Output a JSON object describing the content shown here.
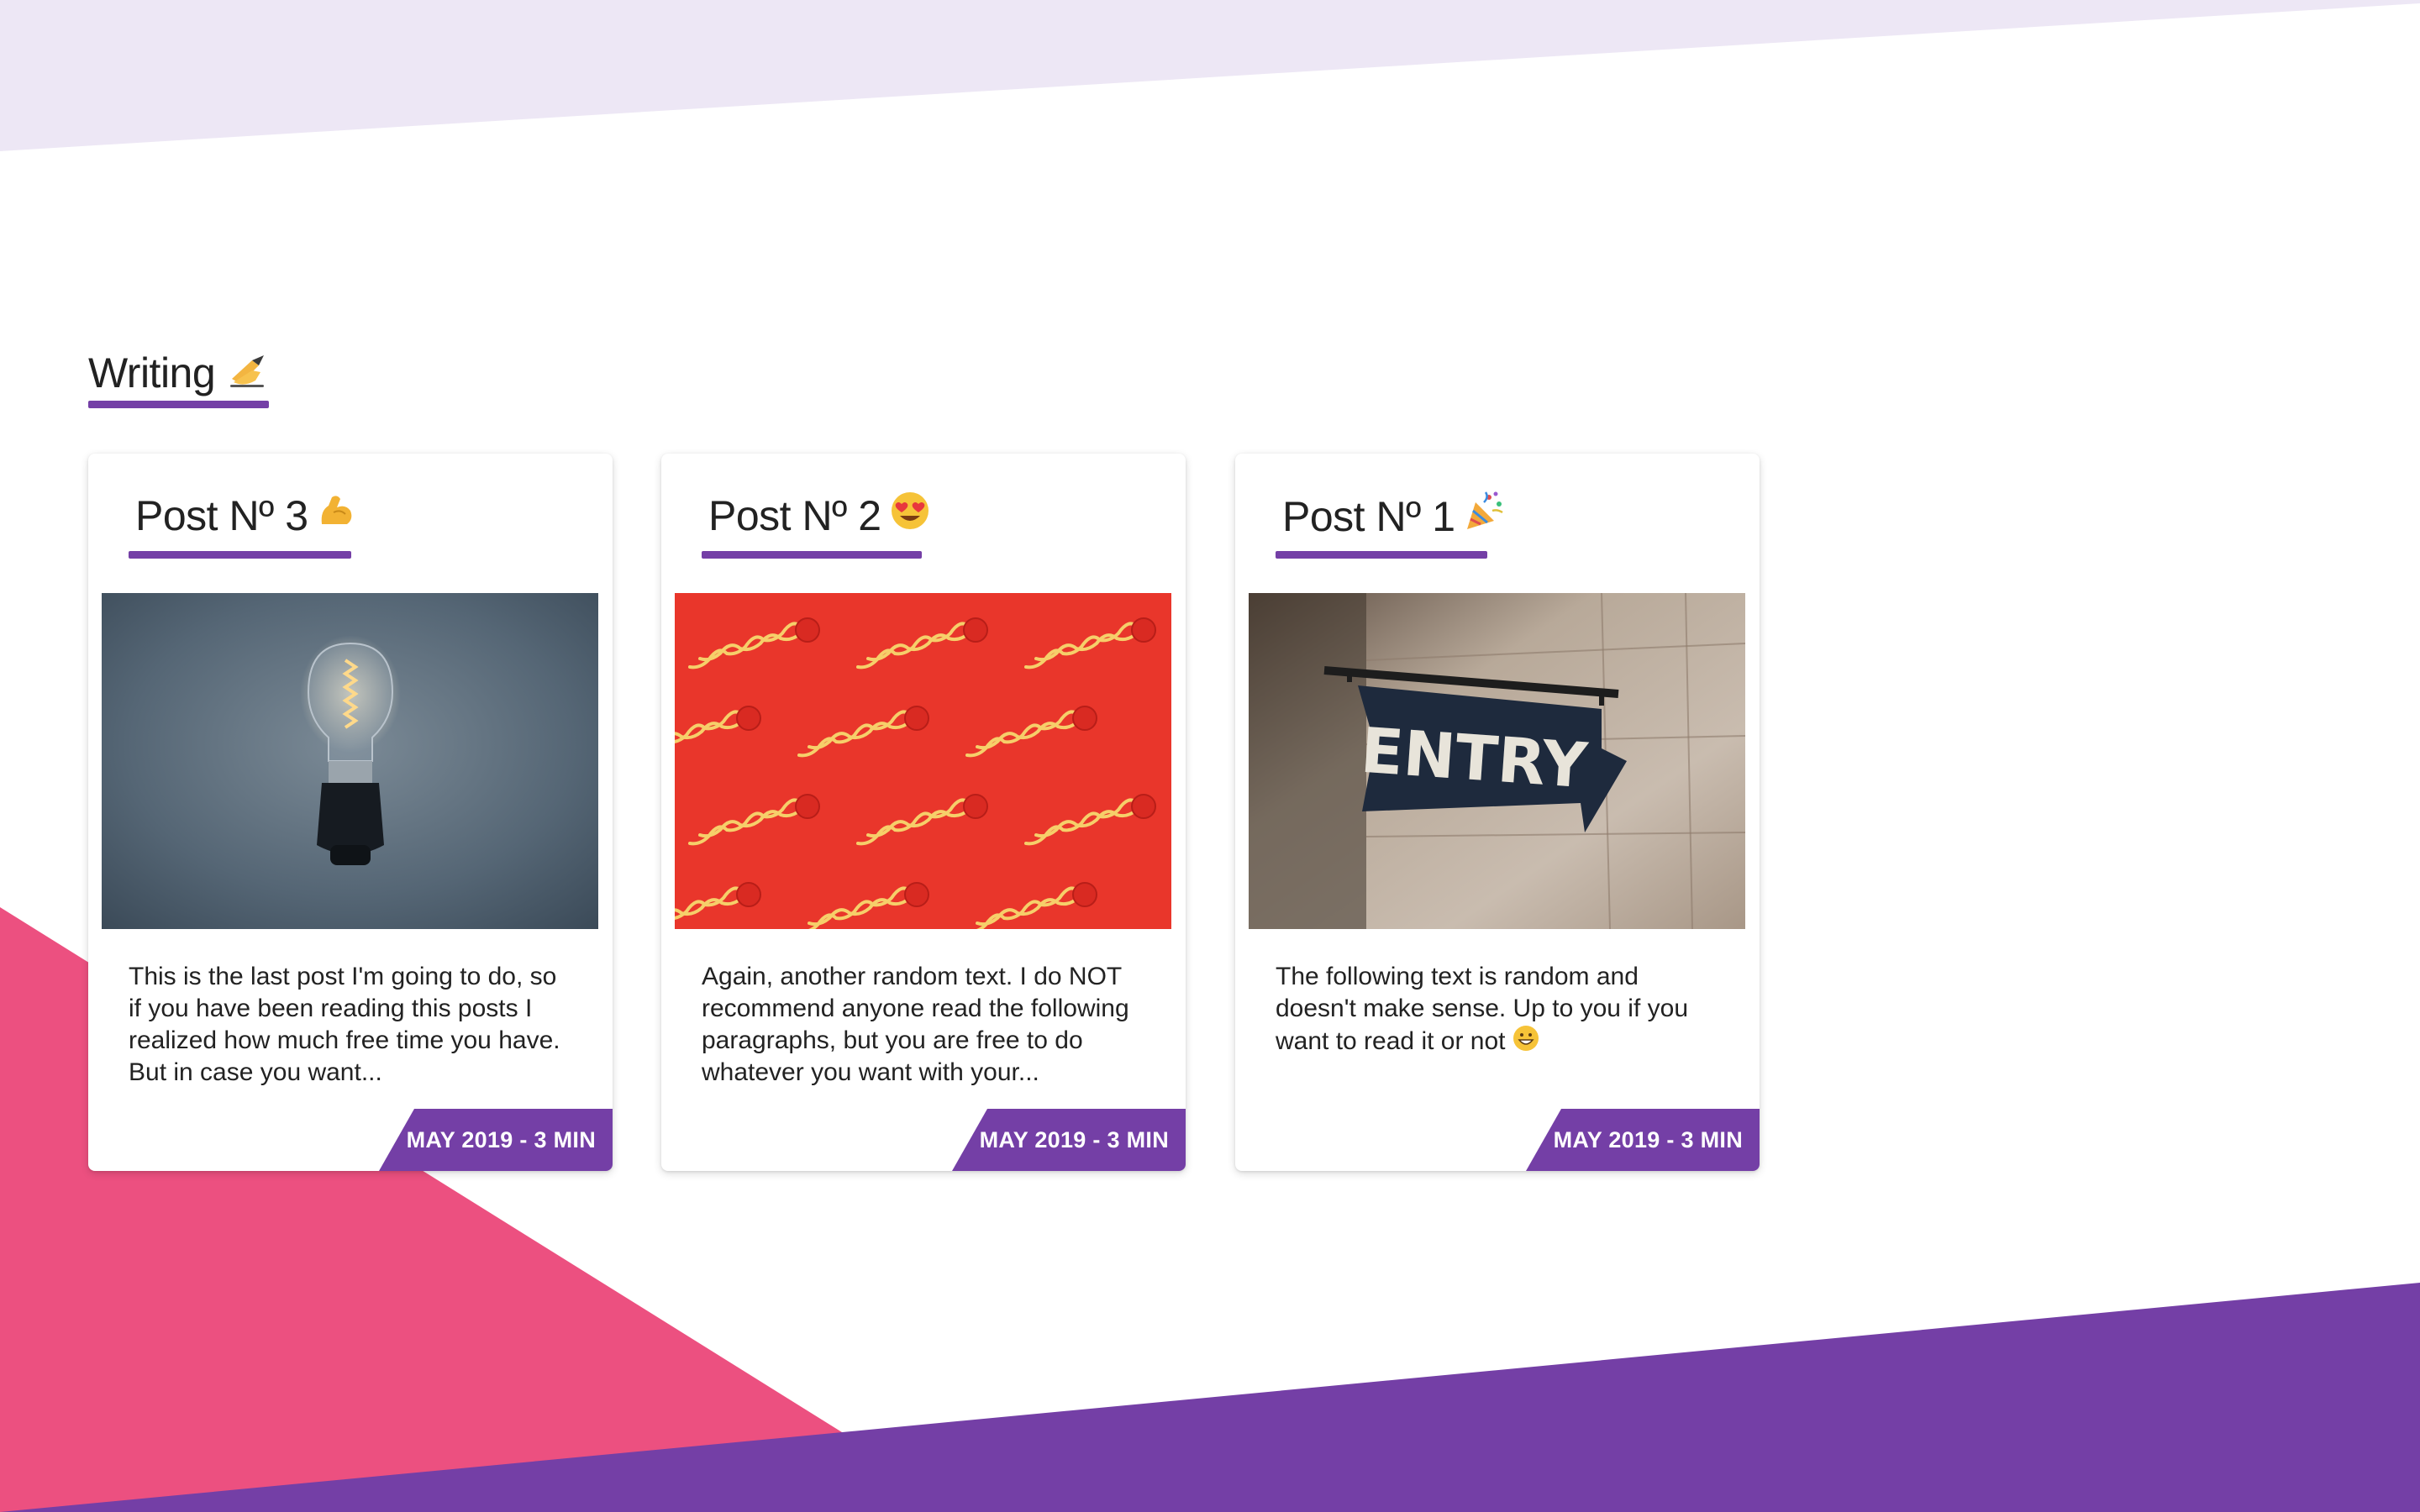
{
  "colors": {
    "accent": "#743fa6",
    "pink": "#ec5080",
    "top_band": "#ede7f5",
    "text": "#222222"
  },
  "section": {
    "title": "Writing",
    "icon": "writing-hand-icon"
  },
  "posts": [
    {
      "title": "Post Nº 3",
      "icon": "flexed-biceps-icon",
      "image": "lightbulb-photo",
      "excerpt": "This is the last post I'm going to do, so if you have been reading this posts I realized how much free time you have. But in case you want...",
      "meta": "MAY 2019 - 3 MIN"
    },
    {
      "title": "Post Nº 2",
      "icon": "heart-eyes-face-icon",
      "image": "noodles-photo",
      "excerpt": "Again, another random text. I do NOT recommend anyone read the following paragraphs, but you are free to do whatever you want with your...",
      "meta": "MAY 2019 - 3 MIN"
    },
    {
      "title": "Post Nº 1",
      "icon": "party-popper-icon",
      "image": "entry-sign-photo",
      "excerpt": "The following text is random and doesn't make sense. Up to you if you want to read it or not",
      "excerpt_icon": "grinning-face-icon",
      "image_text": "ENTRY",
      "meta": "MAY 2019 - 3 MIN"
    }
  ]
}
